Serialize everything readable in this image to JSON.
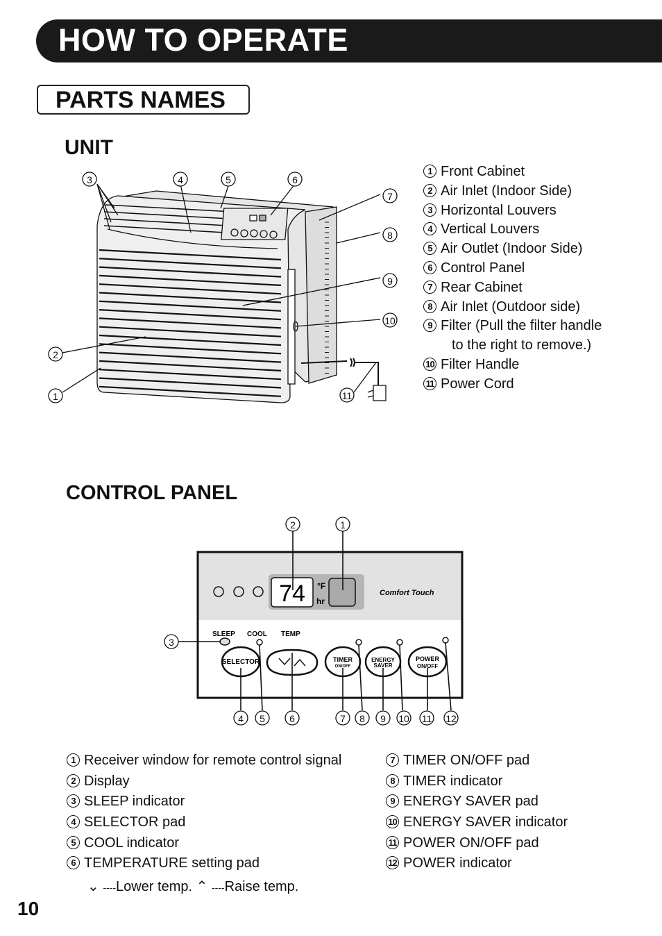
{
  "header": {
    "title": "HOW TO OPERATE"
  },
  "section": {
    "title": "PARTS NAMES"
  },
  "unit": {
    "heading": "UNIT",
    "callouts": [
      "1",
      "2",
      "3",
      "4",
      "5",
      "6",
      "7",
      "8",
      "9",
      "10",
      "11"
    ],
    "parts": [
      {
        "num": "1",
        "label": "Front Cabinet"
      },
      {
        "num": "2",
        "label": "Air Inlet  (Indoor Side)"
      },
      {
        "num": "3",
        "label": "Horizontal Louvers"
      },
      {
        "num": "4",
        "label": "Vertical Louvers"
      },
      {
        "num": "5",
        "label": "Air Outlet (Indoor Side)"
      },
      {
        "num": "6",
        "label": "Control Panel"
      },
      {
        "num": "7",
        "label": "Rear Cabinet"
      },
      {
        "num": "8",
        "label": "Air Inlet (Outdoor side)"
      },
      {
        "num": "9",
        "label": "Filter (Pull the filter handle",
        "continuation": "to the right to remove.)"
      },
      {
        "num": "10",
        "label": "Filter Handle"
      },
      {
        "num": "11",
        "label": "Power Cord"
      }
    ]
  },
  "control_panel": {
    "heading": "CONTROL PANEL",
    "display_value": "74",
    "unit_f": "°F",
    "unit_hr": "hr",
    "brand": "Comfort Touch",
    "indicator_labels": {
      "sleep": "SLEEP",
      "cool": "COOL",
      "temp": "TEMP"
    },
    "buttons": {
      "selector": "SELECTOR",
      "timer": "TIMER",
      "timer_sub": "ON/OFF",
      "energy1": "ENERGY",
      "energy2": "SAVER",
      "power": "POWER",
      "power_sub": "ON/OFF"
    },
    "callouts": [
      "1",
      "2",
      "3",
      "4",
      "5",
      "6",
      "7",
      "8",
      "9",
      "10",
      "11",
      "12"
    ],
    "left_items": [
      {
        "num": "1",
        "label": "Receiver window for remote control signal"
      },
      {
        "num": "2",
        "label": "Display"
      },
      {
        "num": "3",
        "label": "SLEEP indicator"
      },
      {
        "num": "4",
        "label": "SELECTOR pad"
      },
      {
        "num": "5",
        "label": "COOL indicator"
      },
      {
        "num": "6",
        "label": "TEMPERATURE setting pad"
      }
    ],
    "temp_note": {
      "dash": "----",
      "lower": "Lower temp.",
      "raise": "Raise temp."
    },
    "right_items": [
      {
        "num": "7",
        "label": "TIMER ON/OFF pad"
      },
      {
        "num": "8",
        "label": "TIMER indicator"
      },
      {
        "num": "9",
        "label": "ENERGY SAVER pad"
      },
      {
        "num": "10",
        "label": "ENERGY SAVER indicator"
      },
      {
        "num": "11",
        "label": "POWER ON/OFF pad"
      },
      {
        "num": "12",
        "label": "POWER indicator"
      }
    ]
  },
  "footer": {
    "page_number": "10"
  }
}
